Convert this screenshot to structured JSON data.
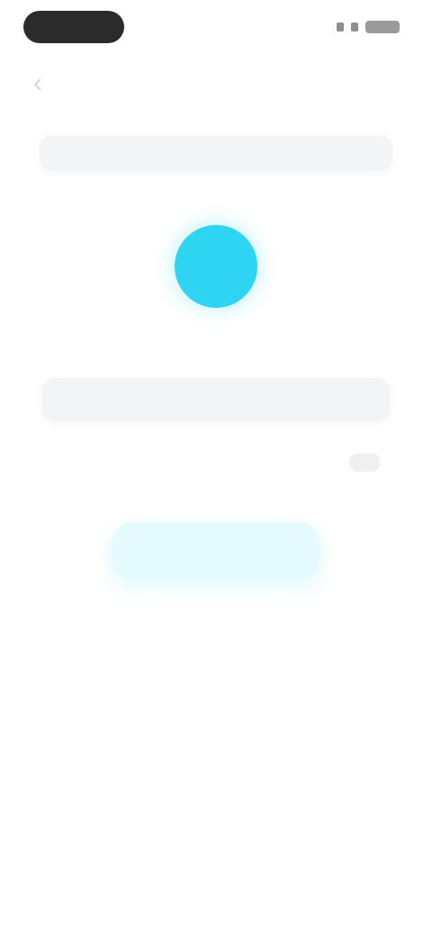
{
  "status_bar": {
    "icons": [
      "signal-icon",
      "battery-icon"
    ]
  },
  "header": {
    "back_icon": "chevron-left-icon",
    "title": ""
  },
  "top_card": {
    "text": ""
  },
  "avatar": {
    "color": "#2fd4f2"
  },
  "name_input": {
    "value": "",
    "placeholder": ""
  },
  "counter": {
    "text": ""
  },
  "primary_button": {
    "label": "",
    "color": "#e6fbff"
  }
}
